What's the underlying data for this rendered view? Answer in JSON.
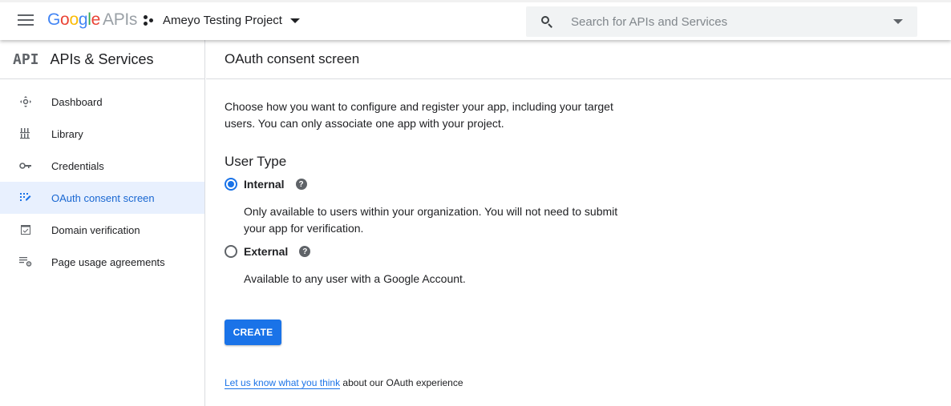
{
  "topbar": {
    "logo_google": [
      "G",
      "o",
      "o",
      "g",
      "l",
      "e"
    ],
    "logo_product": "APIs",
    "project_name": "Ameyo Testing Project",
    "search_placeholder": "Search for APIs and Services",
    "search_value": ""
  },
  "sidebar": {
    "logo_text": "API",
    "title": "APIs & Services",
    "items": [
      {
        "label": "Dashboard",
        "icon": "dashboard-icon",
        "active": false
      },
      {
        "label": "Library",
        "icon": "library-icon",
        "active": false
      },
      {
        "label": "Credentials",
        "icon": "key-icon",
        "active": false
      },
      {
        "label": "OAuth consent screen",
        "icon": "oauth-consent-icon",
        "active": true
      },
      {
        "label": "Domain verification",
        "icon": "domain-verification-icon",
        "active": false
      },
      {
        "label": "Page usage agreements",
        "icon": "page-usage-settings-icon",
        "active": false
      }
    ]
  },
  "main": {
    "title": "OAuth consent screen",
    "intro": "Choose how you want to configure and register your app, including your target users. You can only associate one app with your project.",
    "user_type_heading": "User Type",
    "options": [
      {
        "label": "Internal",
        "selected": true,
        "help": "?",
        "description": "Only available to users within your organization. You will not need to submit your app for verification."
      },
      {
        "label": "External",
        "selected": false,
        "help": "?",
        "description": "Available to any user with a Google Account."
      }
    ],
    "create_label": "CREATE",
    "feedback_link": "Let us know what you think",
    "feedback_rest": " about our OAuth experience"
  },
  "colors": {
    "accent": "#1a73e8",
    "active_bg": "#e8f0fe",
    "active_text": "#1967d2"
  }
}
